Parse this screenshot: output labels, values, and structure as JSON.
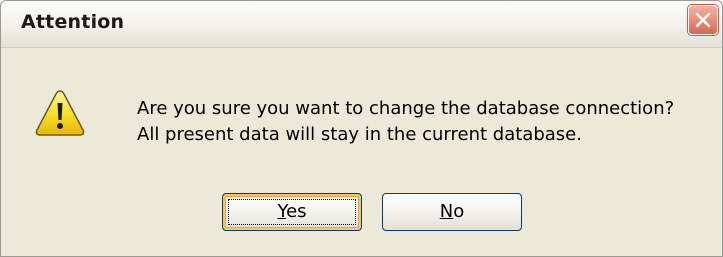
{
  "window": {
    "title": "Attention",
    "close_icon": "close-icon"
  },
  "message": {
    "icon": "warning-icon",
    "line1": "Are you sure you want to change the database connection?",
    "line2": "All present data will stay in the current database."
  },
  "buttons": {
    "yes": {
      "mnemonic": "Y",
      "rest": "es"
    },
    "no": {
      "mnemonic": "N",
      "rest": "o"
    }
  },
  "colors": {
    "dialog_bg": "#ece9d8",
    "close_red": "#e98d79",
    "button_border": "#003c74",
    "warning_yellow": "#f6d21a"
  }
}
